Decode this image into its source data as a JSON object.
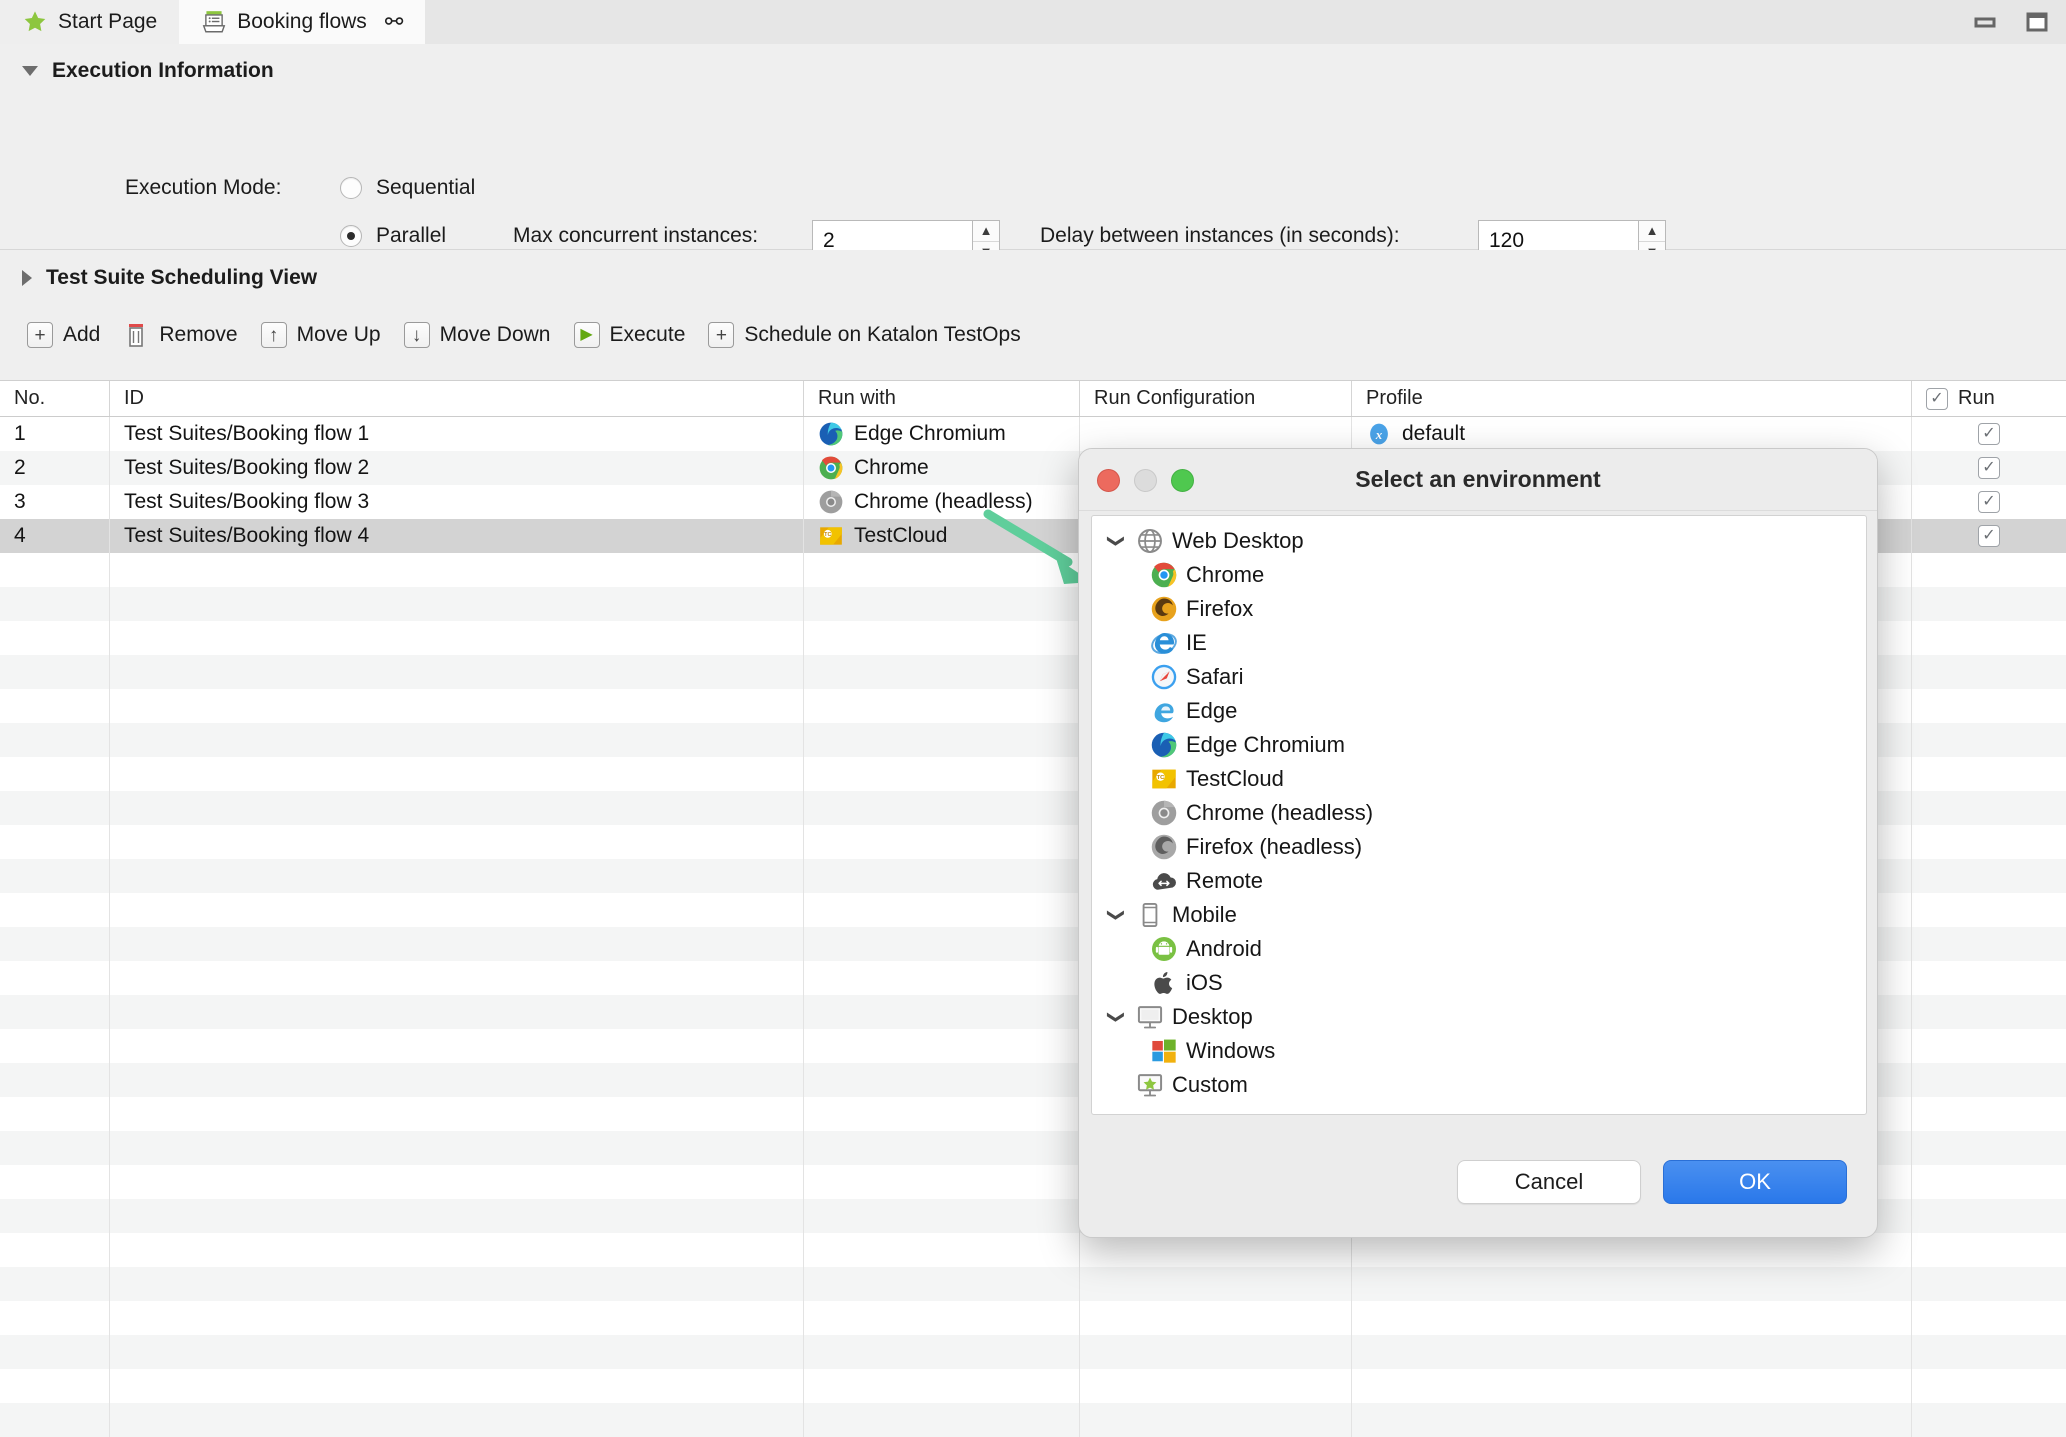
{
  "window": {
    "tabs": [
      {
        "label": "Start Page",
        "icon": "star-icon",
        "active": false,
        "closable": false
      },
      {
        "label": "Booking flows",
        "icon": "test-suite-collection-icon",
        "active": true,
        "closable": true
      }
    ],
    "controls": [
      {
        "name": "minimize-button",
        "glyph": "minimize-icon"
      },
      {
        "name": "maximize-button",
        "glyph": "maximize-icon"
      }
    ]
  },
  "execution_information": {
    "title": "Execution Information",
    "expanded": true,
    "execution_mode_label": "Execution Mode:",
    "modes": [
      {
        "label": "Sequential",
        "selected": false
      },
      {
        "label": "Parallel",
        "selected": true
      }
    ],
    "max_concurrent_label": "Max concurrent instances:",
    "max_concurrent_value": "2",
    "delay_label": "Delay between instances (in seconds):",
    "delay_value": "120"
  },
  "scheduling_view": {
    "title": "Test Suite Scheduling View",
    "expanded": false,
    "toolbar": [
      {
        "label": "Add",
        "icon": "plus-box-icon"
      },
      {
        "label": "Remove",
        "icon": "trash-icon"
      },
      {
        "label": "Move Up",
        "icon": "arrow-up-box-icon"
      },
      {
        "label": "Move Down",
        "icon": "arrow-down-box-icon"
      },
      {
        "label": "Execute",
        "icon": "play-box-icon"
      },
      {
        "label": "Schedule on Katalon TestOps",
        "icon": "plus-box-icon"
      }
    ]
  },
  "table": {
    "columns": [
      "No.",
      "ID",
      "Run with",
      "Run Configuration",
      "Profile",
      "Run"
    ],
    "header_run_checkbox": "checked",
    "rows": [
      {
        "no": "1",
        "id": "Test Suites/Booking flow 1",
        "run_with": "Edge Chromium",
        "run_with_icon": "edge-chromium-icon",
        "run_configuration": "",
        "profile": "default",
        "profile_icon": "profile-x-icon",
        "run": true,
        "selected": false
      },
      {
        "no": "2",
        "id": "Test Suites/Booking flow 2",
        "run_with": "Chrome",
        "run_with_icon": "chrome-icon",
        "run_configuration": "",
        "profile": "",
        "profile_icon": "profile-x-icon",
        "run": true,
        "selected": false
      },
      {
        "no": "3",
        "id": "Test Suites/Booking flow 3",
        "run_with": "Chrome (headless)",
        "run_with_icon": "chrome-headless-icon",
        "run_configuration": "",
        "profile": "",
        "profile_icon": "",
        "run": true,
        "selected": false
      },
      {
        "no": "4",
        "id": "Test Suites/Booking flow 4",
        "run_with": "TestCloud",
        "run_with_icon": "testcloud-icon",
        "run_configuration": "",
        "profile": "",
        "profile_icon": "",
        "run": true,
        "selected": true
      }
    ],
    "empty_row_count": 26
  },
  "annotation": {
    "arrow_color": "#5fce9b",
    "arrow_from": "TestCloud cell",
    "arrow_to": "Select an environment dialog"
  },
  "dialog": {
    "title": "Select an environment",
    "traffic_lights": [
      "close-button",
      "minimize-button",
      "zoom-button"
    ],
    "tree": [
      {
        "label": "Web Desktop",
        "icon": "globe-icon",
        "level": 0,
        "expanded": true
      },
      {
        "label": "Chrome",
        "icon": "chrome-icon",
        "level": 1
      },
      {
        "label": "Firefox",
        "icon": "firefox-icon",
        "level": 1
      },
      {
        "label": "IE",
        "icon": "ie-icon",
        "level": 1
      },
      {
        "label": "Safari",
        "icon": "safari-icon",
        "level": 1
      },
      {
        "label": "Edge",
        "icon": "edge-icon",
        "level": 1
      },
      {
        "label": "Edge Chromium",
        "icon": "edge-chromium-icon",
        "level": 1
      },
      {
        "label": "TestCloud",
        "icon": "testcloud-icon",
        "level": 1
      },
      {
        "label": "Chrome (headless)",
        "icon": "chrome-headless-icon",
        "level": 1
      },
      {
        "label": "Firefox (headless)",
        "icon": "firefox-headless-icon",
        "level": 1
      },
      {
        "label": "Remote",
        "icon": "remote-cloud-icon",
        "level": 1
      },
      {
        "label": "Mobile",
        "icon": "mobile-icon",
        "level": 0,
        "expanded": true
      },
      {
        "label": "Android",
        "icon": "android-icon",
        "level": 1
      },
      {
        "label": "iOS",
        "icon": "apple-icon",
        "level": 1
      },
      {
        "label": "Desktop",
        "icon": "monitor-icon",
        "level": 0,
        "expanded": true
      },
      {
        "label": "Windows",
        "icon": "windows-icon",
        "level": 1
      },
      {
        "label": "Custom",
        "icon": "custom-monitor-star-icon",
        "level": 0
      }
    ],
    "buttons": {
      "cancel": "Cancel",
      "ok": "OK"
    }
  },
  "colors": {
    "accent_blue": "#2a78ea",
    "annotation_green": "#5fce9b",
    "selected_row": "#d3d3d3",
    "tab_active": "#fafafa"
  }
}
